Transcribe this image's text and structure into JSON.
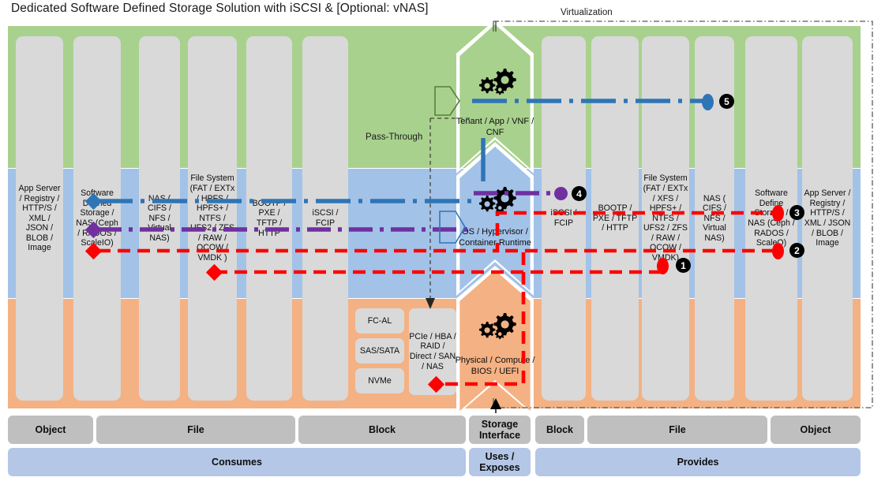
{
  "title": "Dedicated Software Defined Storage Solution with iSCSI & [Optional: vNAS]",
  "annotations": {
    "virtualization": "Virtualization",
    "pass_through": "Pass-Through"
  },
  "left_columns": [
    {
      "name": "app-server-left",
      "text": "App Server / Registry / HTTP/S / XML / JSON / BLOB / Image"
    },
    {
      "name": "sds-nas-left",
      "text": "Software Defined Storage / NAS (Ceph / RADOS / ScaleIO)"
    },
    {
      "name": "nas-left",
      "text": "NAS ( CIFS / NFS / Virtual NAS)"
    },
    {
      "name": "file-system-left",
      "text": "File System (FAT / EXTx / HPFS / HPFS+ / NTFS / UFS2 / ZFS / RAW / QCOW / VMDK )"
    },
    {
      "name": "bootp-left",
      "text": "BOOTP / PXE / TFTP / HTTP"
    },
    {
      "name": "iscsi-left",
      "text": "iSCSI / FCIP"
    }
  ],
  "right_columns": [
    {
      "name": "iscsi-right",
      "text": "iSCSI / FCIP"
    },
    {
      "name": "bootp-right",
      "text": "BOOTP / PXE / TFTP / HTTP"
    },
    {
      "name": "file-system-right",
      "text": "File System (FAT / EXTx / XFS / HPFS+ / NTFS / UFS2 / ZFS /  RAW / QCOW / VMDK)"
    },
    {
      "name": "nas-right",
      "text": "NAS ( CIFS / NFS / Virtual NAS)"
    },
    {
      "name": "sds-nas-right",
      "text": "Software Define Storage / NAS (Ceph / RADOS / ScaleO)"
    },
    {
      "name": "app-server-right",
      "text": "App Server / Registry / HTTP/S / XML / JSON / BLOB / Image"
    }
  ],
  "center_stack": [
    {
      "name": "tenant-app",
      "text": "Tenant / App / VNF / CNF"
    },
    {
      "name": "os-hypervisor",
      "text": "OS / Hypervisor / Container Runtime"
    },
    {
      "name": "physical-compute",
      "text": "Physical / Compute / BIOS / UEFI"
    }
  ],
  "interface_boxes": [
    {
      "name": "fc-al-box",
      "text": "FC-AL"
    },
    {
      "name": "sas-sata-box",
      "text": "SAS/SATA"
    },
    {
      "name": "nvme-box",
      "text": "NVMe"
    }
  ],
  "transport_box": {
    "name": "pcie-hba-box",
    "text": "PCIe / HBA / RAID / Direct / SAN / NAS"
  },
  "legend": {
    "top_row": [
      {
        "name": "legend-object-left",
        "text": "Object"
      },
      {
        "name": "legend-file-left",
        "text": "File"
      },
      {
        "name": "legend-block-left",
        "text": "Block"
      },
      {
        "name": "legend-storage-interface",
        "text": "Storage Interface"
      },
      {
        "name": "legend-block-right",
        "text": "Block"
      },
      {
        "name": "legend-file-right",
        "text": "File"
      },
      {
        "name": "legend-object-right",
        "text": "Object"
      }
    ],
    "bottom_row": [
      {
        "name": "legend-consumes",
        "text": "Consumes"
      },
      {
        "name": "legend-uses-exposes",
        "text": "Uses / Exposes"
      },
      {
        "name": "legend-provides",
        "text": "Provides"
      }
    ]
  },
  "markers": [
    {
      "id": "1",
      "glyph": "❶"
    },
    {
      "id": "2",
      "glyph": "❷"
    },
    {
      "id": "3",
      "glyph": "❸"
    },
    {
      "id": "4",
      "glyph": "❹"
    },
    {
      "id": "5",
      "glyph": "❺"
    }
  ],
  "colors": {
    "band_green": "#a9d18e",
    "band_blue": "#a3c2e8",
    "band_orange": "#f4b183",
    "column_gray": "#d9d9d9",
    "legend_gray": "#bfbfbf",
    "legend_blue": "#b4c7e7",
    "flow_blue": "#2e75b6",
    "flow_purple": "#7030a0",
    "flow_red": "#ff0000"
  }
}
